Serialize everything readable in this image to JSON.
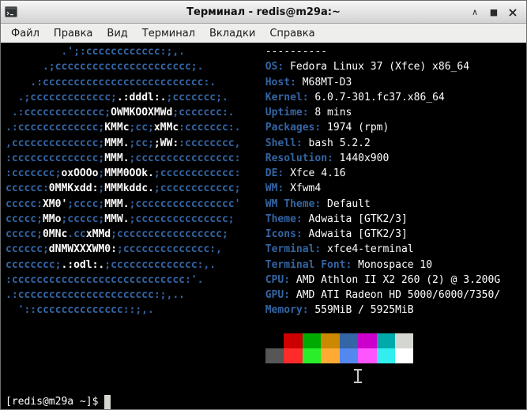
{
  "window": {
    "title": "Терминал - redis@m29a:~",
    "icons": {
      "minimize_glyph": "∧",
      "maximize_glyph": "■",
      "close_glyph": "×"
    }
  },
  "menu_bar": {
    "items": [
      {
        "name": "file",
        "label": "Файл"
      },
      {
        "name": "edit",
        "label": "Правка"
      },
      {
        "name": "view",
        "label": "Вид"
      },
      {
        "name": "terminal",
        "label": "Терминал"
      },
      {
        "name": "tabs",
        "label": "Вкладки"
      },
      {
        "name": "help",
        "label": "Справка"
      }
    ]
  },
  "terminal": {
    "colors": {
      "background": "#000000",
      "foreground": "#ffffff",
      "art_blue": "#3465a4",
      "art_white": "#ffffff",
      "label_blue": "#3465a4",
      "cursor": "#d3d7cf"
    },
    "layout": {
      "art_pad_cols": 42
    },
    "info_header_separator": "----------",
    "ascii_art": [
      [
        [
          "b",
          "         .';:cccccccccccc:;,."
        ]
      ],
      [
        [
          "b",
          "      .;cccccccccccccccccccccc;."
        ]
      ],
      [
        [
          "b",
          "    .:cccccccccccccccccccccccccc:."
        ]
      ],
      [
        [
          "b",
          "  .;ccccccccccccc;"
        ],
        [
          "w",
          ".:dddl:."
        ],
        [
          "b",
          ";ccccccc;."
        ]
      ],
      [
        [
          "b",
          " .:ccccccccccccc;"
        ],
        [
          "w",
          "OWMKOOXMWd"
        ],
        [
          "b",
          ";ccccccc:."
        ]
      ],
      [
        [
          "b",
          ".:ccccccccccccc;"
        ],
        [
          "w",
          "KMMc"
        ],
        [
          "b",
          ";cc;"
        ],
        [
          "w",
          "xMMc"
        ],
        [
          "b",
          ":ccccccc:."
        ]
      ],
      [
        [
          "b",
          ",cccccccccccccc;"
        ],
        [
          "w",
          "MMM."
        ],
        [
          "b",
          ";cc;"
        ],
        [
          "w",
          ";WW:"
        ],
        [
          "b",
          ":cccccccc,"
        ]
      ],
      [
        [
          "b",
          ":cccccccccccccc;"
        ],
        [
          "w",
          "MMM."
        ],
        [
          "b",
          ";cccccccccccccccc:"
        ]
      ],
      [
        [
          "b",
          ":ccccccc;"
        ],
        [
          "w",
          "oxOOOo"
        ],
        [
          "b",
          ";"
        ],
        [
          "w",
          "MMM0OOk."
        ],
        [
          "b",
          ";cccccccccccc:"
        ]
      ],
      [
        [
          "b",
          "cccccc:"
        ],
        [
          "w",
          "0MMKxdd:"
        ],
        [
          "b",
          ";"
        ],
        [
          "w",
          "MMMkddc."
        ],
        [
          "b",
          ";cccccccccccc;"
        ]
      ],
      [
        [
          "b",
          "ccccc:"
        ],
        [
          "w",
          "XM0'"
        ],
        [
          "b",
          ";cccc;"
        ],
        [
          "w",
          "MMM."
        ],
        [
          "b",
          ";cccccccccccccccc'"
        ]
      ],
      [
        [
          "b",
          "ccccc;"
        ],
        [
          "w",
          "MMo"
        ],
        [
          "b",
          ";ccccc;"
        ],
        [
          "w",
          "MMW."
        ],
        [
          "b",
          ";ccccccccccccccc;"
        ]
      ],
      [
        [
          "b",
          "ccccc;"
        ],
        [
          "w",
          "0MNc"
        ],
        [
          "b",
          ".cc"
        ],
        [
          "w",
          "xMMd"
        ],
        [
          "b",
          ";ccccccccccccccccc;"
        ]
      ],
      [
        [
          "b",
          "cccccc;"
        ],
        [
          "w",
          "dNMWXXXWM0:"
        ],
        [
          "b",
          ";cccccccccccccc:,"
        ]
      ],
      [
        [
          "b",
          "cccccccc;"
        ],
        [
          "w",
          ".:odl:."
        ],
        [
          "b",
          ";cccccccccccccc:,."
        ]
      ],
      [
        [
          "b",
          ":cccccccccccccccccccccccccccc:'."
        ]
      ],
      [
        [
          "b",
          ".:cccccccccccccccccccccc:;,.."
        ]
      ],
      [
        [
          "b",
          "  '::cccccccccccccc::;,."
        ]
      ]
    ],
    "info": [
      {
        "label": "OS:",
        "value": "Fedora Linux 37 (Xfce) x86_64"
      },
      {
        "label": "Host:",
        "value": "M68MT-D3"
      },
      {
        "label": "Kernel:",
        "value": "6.0.7-301.fc37.x86_64"
      },
      {
        "label": "Uptime:",
        "value": "8 mins"
      },
      {
        "label": "Packages:",
        "value": "1974 (rpm)"
      },
      {
        "label": "Shell:",
        "value": "bash 5.2.2"
      },
      {
        "label": "Resolution:",
        "value": "1440x900"
      },
      {
        "label": "DE:",
        "value": "Xfce 4.16"
      },
      {
        "label": "WM:",
        "value": "Xfwm4"
      },
      {
        "label": "WM Theme:",
        "value": "Default"
      },
      {
        "label": "Theme:",
        "value": "Adwaita [GTK2/3]"
      },
      {
        "label": "Icons:",
        "value": "Adwaita [GTK2/3]"
      },
      {
        "label": "Terminal:",
        "value": "xfce4-terminal"
      },
      {
        "label": "Terminal Font:",
        "value": "Monospace 10"
      },
      {
        "label": "CPU:",
        "value": "AMD Athlon II X2 260 (2) @ 3.200G"
      },
      {
        "label": "GPU:",
        "value": "AMD ATI Radeon HD 5000/6000/7350/"
      },
      {
        "label": "Memory:",
        "value": "559MiB / 5925MiB"
      }
    ],
    "palette": {
      "row1": [
        "#000000",
        "#cc0000",
        "#00aa00",
        "#cc8800",
        "#3465a4",
        "#cc00cc",
        "#00aaaa",
        "#d3d7cf"
      ],
      "row2": [
        "#565656",
        "#ff2a2a",
        "#2aee2a",
        "#ffaa33",
        "#5588ee",
        "#ff55ff",
        "#33eeee",
        "#ffffff"
      ]
    },
    "blank_lines_after_info": 1,
    "blank_lines_after_palette": 2,
    "prompt": "[redis@m29a ~]$ "
  }
}
